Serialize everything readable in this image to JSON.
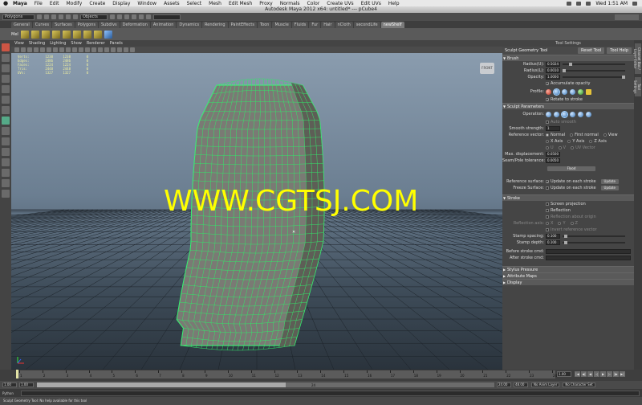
{
  "menubar": {
    "app": "Maya",
    "items": [
      "File",
      "Edit",
      "Modify",
      "Create",
      "Display",
      "Window",
      "Assets",
      "Select",
      "Mesh",
      "Edit Mesh",
      "Proxy",
      "Normals",
      "Color",
      "Create UVs",
      "Edit UVs",
      "Help"
    ],
    "clock": "Wed 1:51 AM"
  },
  "window": {
    "title": "Autodesk Maya 2012 x64: untitled*   ---   pCube4"
  },
  "statusline": {
    "mode": "Polygons",
    "objects_label": "Objects"
  },
  "shelf": {
    "tabs": [
      "General",
      "Curves",
      "Surfaces",
      "Polygons",
      "Subdivs",
      "Deformation",
      "Animation",
      "Dynamics",
      "Rendering",
      "PaintEffects",
      "Toon",
      "Muscle",
      "Fluids",
      "Fur",
      "Hair",
      "nCloth",
      "secondLife",
      "newShelf"
    ],
    "active_tab": "newShelf",
    "first_icon_label": "Mel"
  },
  "panel_menu": [
    "View",
    "Shading",
    "Lighting",
    "Show",
    "Renderer",
    "Panels"
  ],
  "hud": {
    "rows": [
      {
        "label": "Verts:",
        "a": "1238",
        "b": "1238",
        "c": "0"
      },
      {
        "label": "Edges:",
        "a": "2486",
        "b": "2486",
        "c": "0"
      },
      {
        "label": "Faces:",
        "a": "1224",
        "b": "1224",
        "c": "0"
      },
      {
        "label": "Tris:",
        "a": "2448",
        "b": "2448",
        "c": "0"
      },
      {
        "label": "UVs:",
        "a": "1327",
        "b": "1327",
        "c": "0"
      }
    ]
  },
  "viewcube": {
    "label": "FRONT"
  },
  "watermark": "WWW.CGTSJ.COM",
  "tool_settings": {
    "header": "Tool Settings",
    "tool_name": "Sculpt Geometry Tool",
    "reset_button": "Reset Tool",
    "help_button": "Tool Help",
    "brush": {
      "title": "Brush",
      "radius_u_label": "Radius(U):",
      "radius_u": "0.5024",
      "radius_l_label": "Radius(L):",
      "radius_l": "0.0010",
      "opacity_label": "Opacity:",
      "opacity": "1.0000",
      "accumulate_label": "Accumulate opacity",
      "profile_label": "Profile:",
      "rotate_label": "Rotate to stroke"
    },
    "sculpt": {
      "title": "Sculpt Parameters",
      "operation_label": "Operation:",
      "auto_smooth_label": "Auto smooth",
      "smooth_strength_label": "Smooth strength:",
      "smooth_strength": "1",
      "reference_vector_label": "Reference vector:",
      "ref_options": [
        "Normal",
        "First normal",
        "View",
        "X Axis",
        "Y Axis",
        "Z Axis",
        "U",
        "V",
        "UV Vector"
      ],
      "max_disp_label": "Max. displacement:",
      "max_disp": "0.0500",
      "seam_label": "Seam/Pole tolerance:",
      "seam": "0.0050",
      "flood_button": "Flood"
    },
    "reference_surface_label": "Reference surface:",
    "reference_surface_check": "Update on each stroke",
    "freeze_surface_label": "Freeze Surface:",
    "freeze_surface_check": "Update on each stroke",
    "update_button": "Update",
    "stroke": {
      "title": "Stroke",
      "screen_projection": "Screen projection",
      "reflection": "Reflection",
      "reflection_origin": "Reflection about origin",
      "reflection_axis_label": "Reflection axis:",
      "axes": [
        "X",
        "Y",
        "Z"
      ],
      "invert_reference": "Invert reference vector",
      "stamp_spacing_label": "Stamp spacing:",
      "stamp_spacing": "0.100",
      "stamp_depth_label": "Stamp depth:",
      "stamp_depth": "0.100",
      "before_cmd_label": "Before stroke cmd:",
      "after_cmd_label": "After stroke cmd:"
    },
    "collapsed_sections": [
      "Stylus Pressure",
      "Attribute Maps",
      "Display"
    ]
  },
  "side_tabs": [
    "Channel Box / Layer Editor",
    "Tool Settings"
  ],
  "time_slider": {
    "ticks": [
      "1",
      "2",
      "3",
      "4",
      "5",
      "6",
      "7",
      "8",
      "9",
      "10",
      "11",
      "12",
      "13",
      "14",
      "15",
      "16",
      "17",
      "18",
      "19",
      "20",
      "21",
      "22",
      "23",
      "24"
    ],
    "current_frame": "1.00"
  },
  "range": {
    "start": "1.00",
    "inner_start": "1.00",
    "mid": "24",
    "end": "24.00",
    "outer_end": "48.00",
    "anim_layer": "No Anim Layer",
    "char_set": "No Character Set"
  },
  "command_line": {
    "language": "Python"
  },
  "help_line": "Sculpt Geometry Tool: No help available for this tool"
}
